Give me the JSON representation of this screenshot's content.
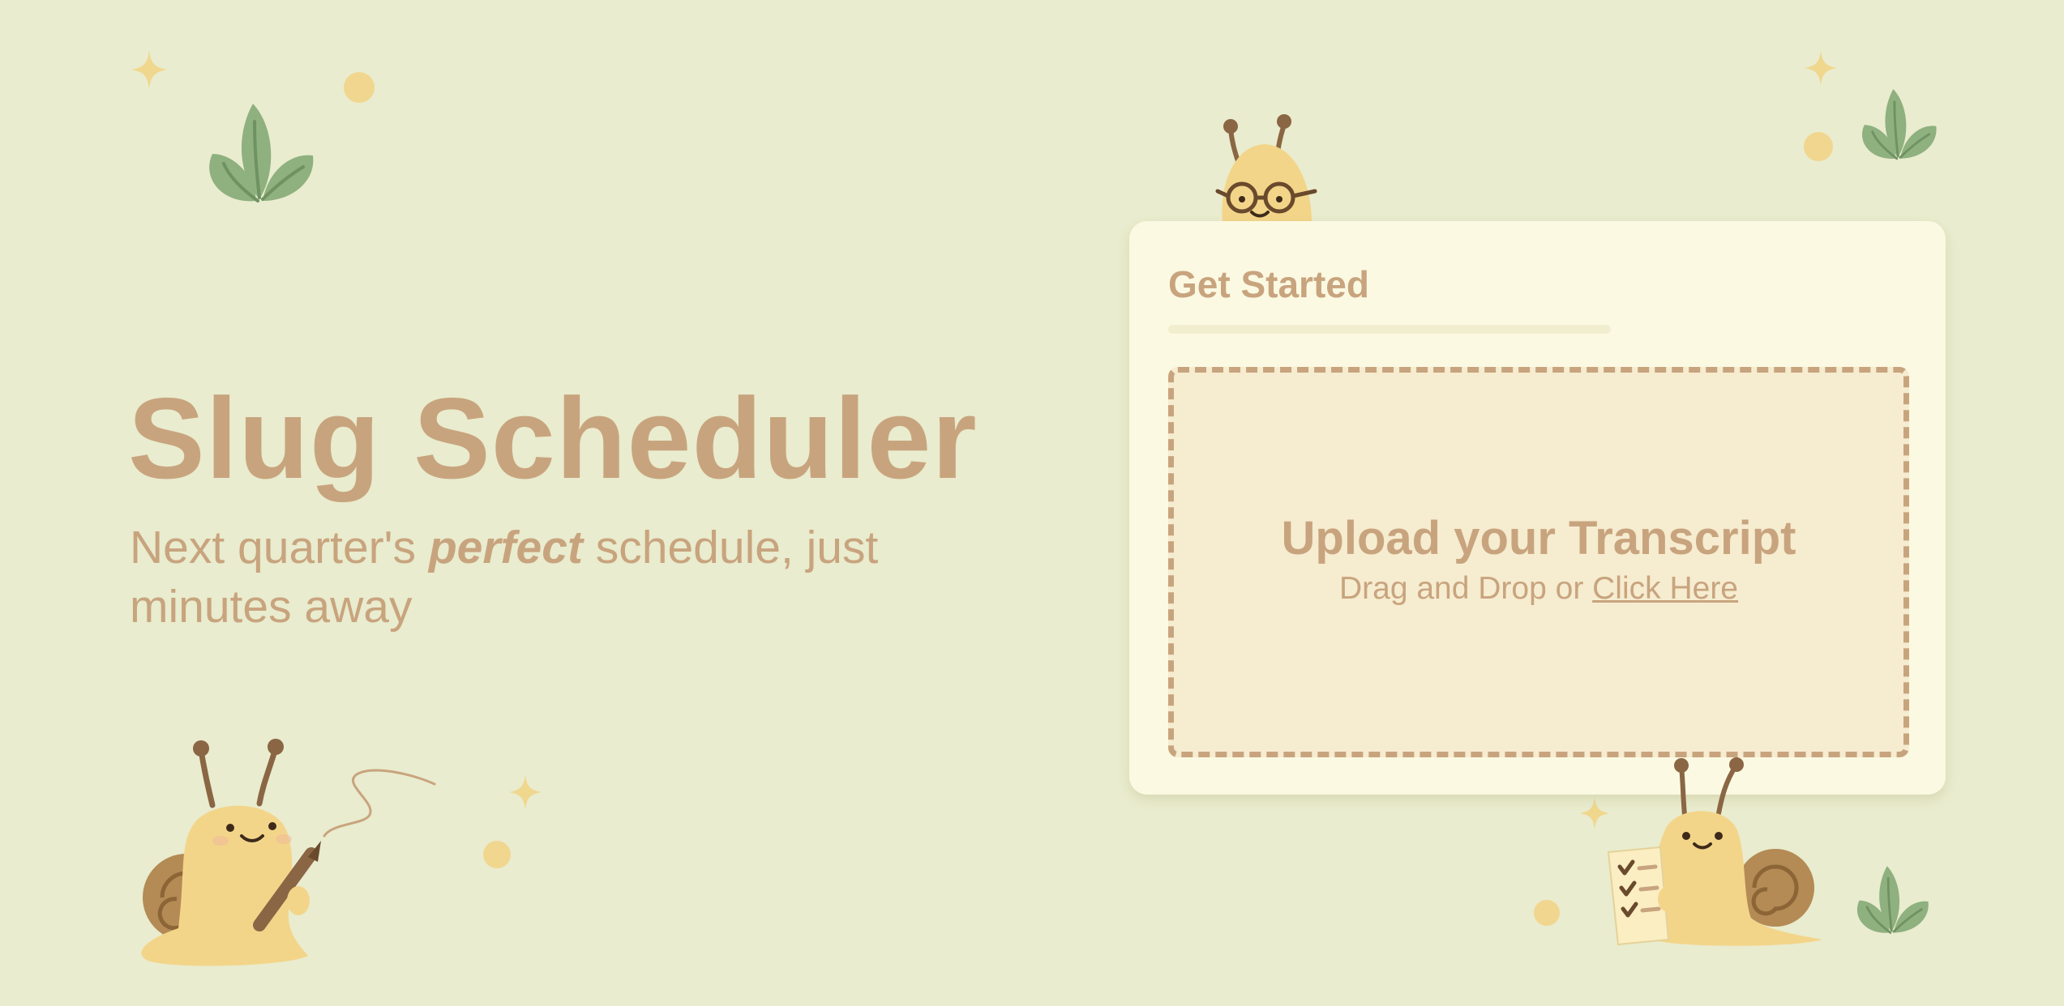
{
  "hero": {
    "title": "Slug Scheduler",
    "subtitle_prefix": "Next quarter's ",
    "subtitle_emphasis": "perfect",
    "subtitle_suffix": " schedule, just minutes away"
  },
  "card": {
    "title": "Get Started",
    "progress": 0,
    "dropzone": {
      "title": "Upload your Transcript",
      "hint_prefix": "Drag and Drop or ",
      "hint_link": "Click Here"
    }
  },
  "decor": {
    "icons": [
      "sparkle-icon",
      "dot-icon",
      "leaf-icon",
      "snail-with-glasses-icon",
      "snail-with-pencil-icon",
      "snail-with-checklist-icon"
    ]
  },
  "colors": {
    "background": "#e9ecce",
    "accent": "#c8a47e",
    "card": "#fbf9e2",
    "dropzone": "#f6ecd0",
    "slug_body": "#f3d58a",
    "shell": "#b48a55",
    "leaf": "#8fb07f"
  }
}
